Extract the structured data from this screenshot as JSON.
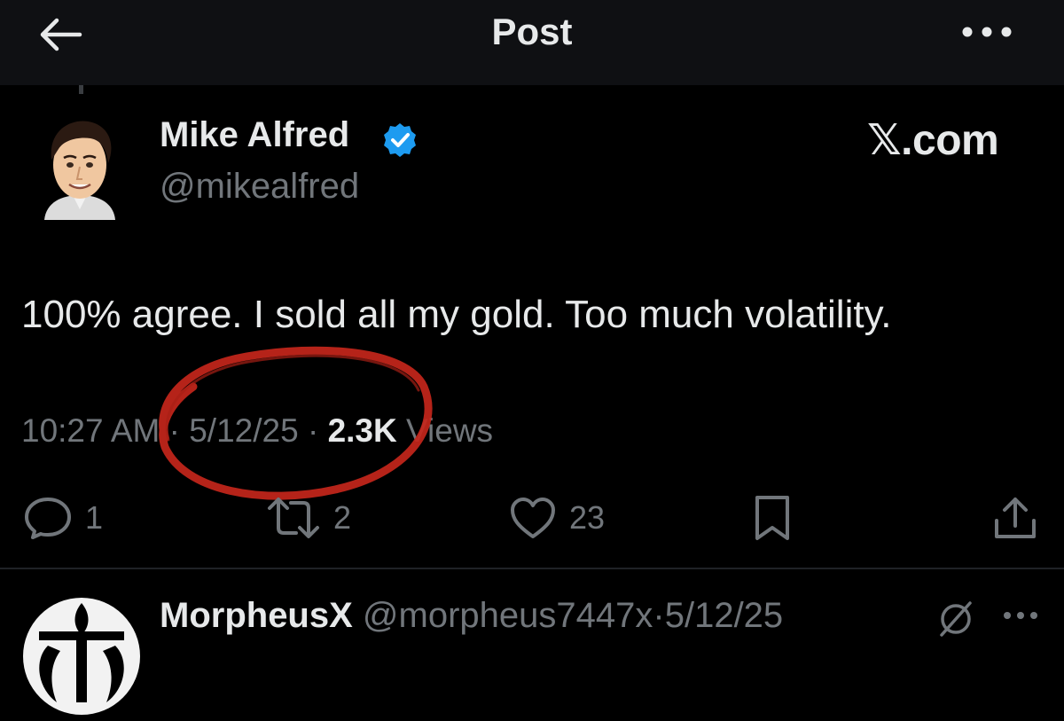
{
  "header": {
    "title": "Post",
    "back_icon": "arrow-left-icon",
    "more_icon": "more-horizontal-icon"
  },
  "post": {
    "author_name": "Mike Alfred",
    "author_handle": "@mikealfred",
    "verified": true,
    "brand": "𝕏.com",
    "text": "100% agree. I sold all my gold. Too much volatility.",
    "time": "10:27 AM",
    "date": "5/12/25",
    "separator": "·",
    "views_count": "2.3K",
    "views_label": "Views",
    "annotation_color": "#c4261b"
  },
  "actions": {
    "reply_count": "1",
    "repost_count": "2",
    "like_count": "23",
    "bookmark_icon": "bookmark-icon",
    "share_icon": "share-icon"
  },
  "reply": {
    "name": "MorpheusX",
    "handle": "@morpheus7447x",
    "separator": "·",
    "date": "5/12/25"
  },
  "colors": {
    "background": "#000000",
    "text": "#e7e9ea",
    "muted": "#71767b",
    "verified": "#1d9bf0"
  }
}
